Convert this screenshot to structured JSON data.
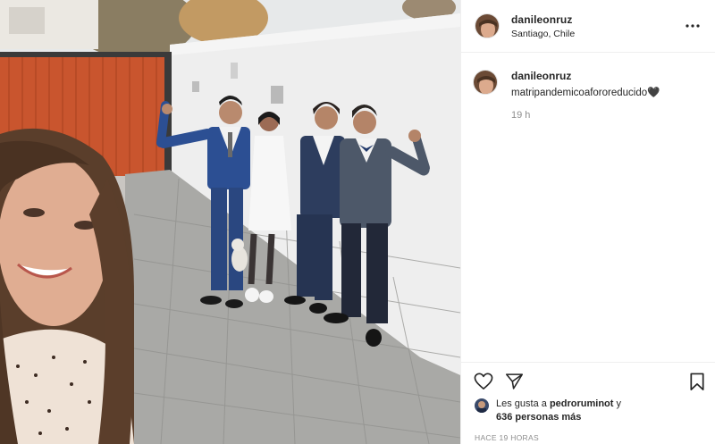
{
  "post": {
    "username": "danileonruz",
    "location": "Santiago, Chile",
    "more_label": "•••",
    "caption_user": "danileonruz",
    "caption_text": "matripandemicoafororeducido🖤",
    "caption_time": "19 h",
    "likes_prefix": "Les gusta a",
    "likes_user": "pedroruminot",
    "likes_conj": "y",
    "likes_others": "636 personas más",
    "timestamp": "HACE 19 HORAS"
  },
  "icons": {
    "more": "more-options-icon",
    "like": "heart-icon",
    "share": "paper-plane-icon",
    "save": "bookmark-icon"
  },
  "colors": {
    "text": "#262626",
    "secondary": "#8e8e8e",
    "border": "#efefef"
  }
}
